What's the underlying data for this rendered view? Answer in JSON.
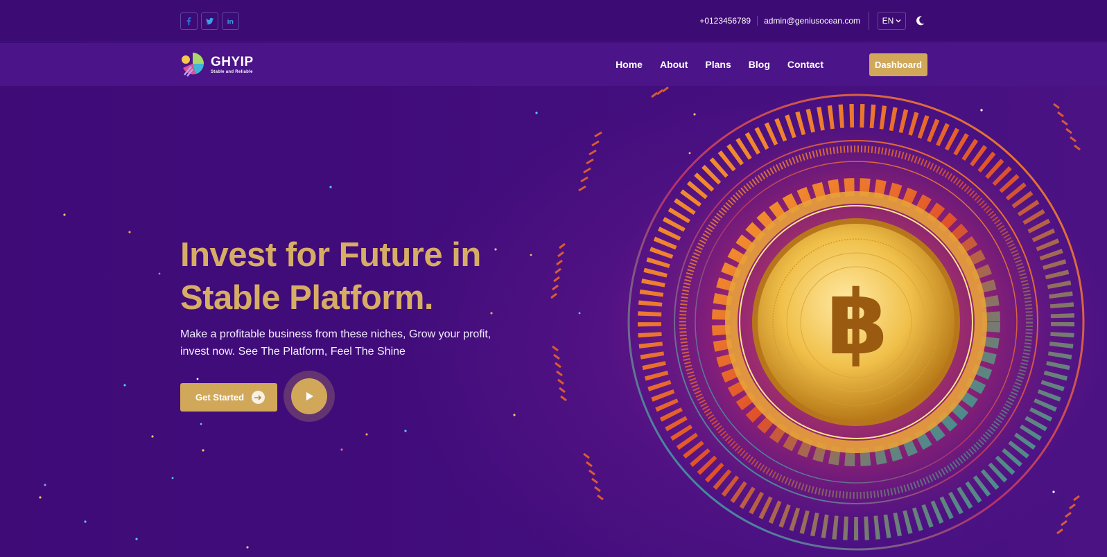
{
  "topbar": {
    "social": [
      "facebook-icon",
      "twitter-icon",
      "linkedin-icon"
    ],
    "phone": "+0123456789",
    "email": "admin@geniusocean.com",
    "language": "EN"
  },
  "navbar": {
    "brand": {
      "name": "GHYIP",
      "tagline": "Stable and Reliable"
    },
    "menu": [
      "Home",
      "About",
      "Plans",
      "Blog",
      "Contact"
    ],
    "dashboard_label": "Dashboard"
  },
  "hero": {
    "title_line1": "Invest for Future in",
    "title_line2": "Stable Platform.",
    "description": "Make a profitable business from these niches, Grow your profit, invest now. See The Platform, Feel The Shine",
    "cta_label": "Get Started"
  },
  "colors": {
    "background": "#3f0c78",
    "navbar": "#4b1488",
    "accent": "#d1a85a",
    "title": "#d7ad66"
  }
}
